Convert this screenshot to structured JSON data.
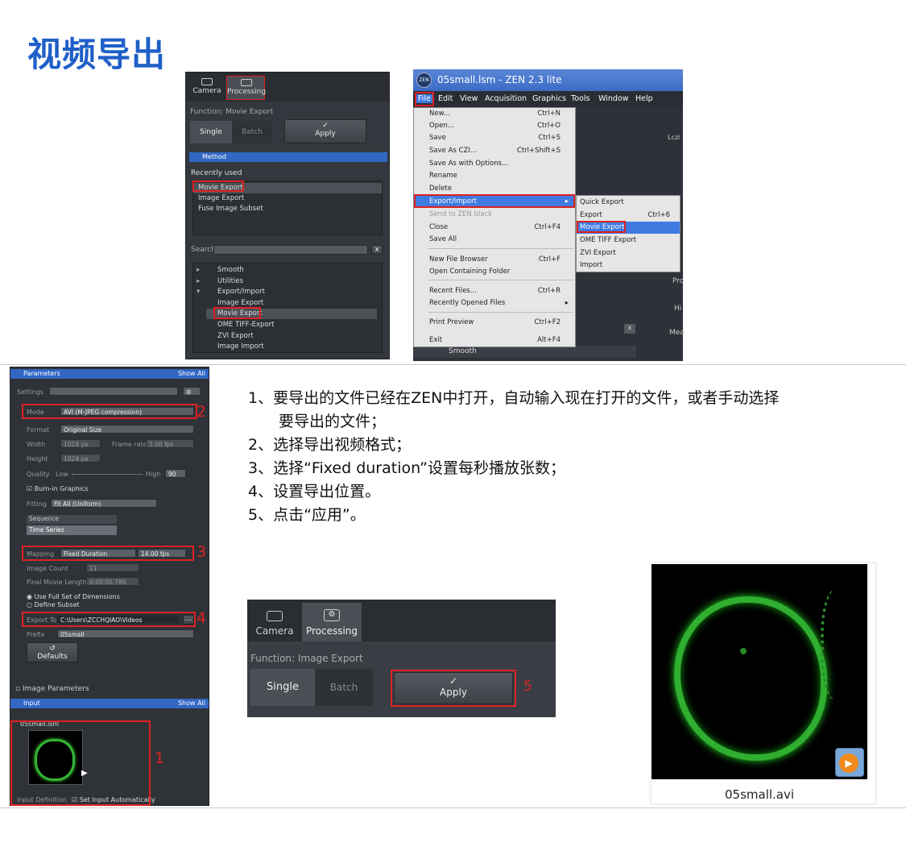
{
  "page": {
    "title": "视频导出"
  },
  "panel_processing": {
    "tabs": [
      "Camera",
      "Processing"
    ],
    "function_label": "Function:",
    "function_value": "Movie Export",
    "single": "Single",
    "batch": "Batch",
    "apply": "Apply",
    "method_header": "Method",
    "recently_used": "Recently used",
    "recent_items": [
      "Movie Export",
      "Image Export",
      "Fuse Image Subset"
    ],
    "search_label": "Search",
    "search_clear": "x",
    "tree": [
      "Smooth",
      "Utilities",
      "Export/Import",
      "Image Export",
      "Movie Export",
      "OME TIFF-Export",
      "ZVI Export",
      "Image Import"
    ]
  },
  "zen_window": {
    "logo": "ZEN",
    "title": "05small.lsm - ZEN 2.3 lite",
    "menubar": [
      "File",
      "Edit",
      "View",
      "Acquisition",
      "Graphics",
      "Tools",
      "Window",
      "Help"
    ],
    "file_menu": [
      {
        "label": "New...",
        "shortcut": "Ctrl+N"
      },
      {
        "label": "Open...",
        "shortcut": "Ctrl+O"
      },
      {
        "label": "Save",
        "shortcut": "Ctrl+S"
      },
      {
        "label": "Save As CZI...",
        "shortcut": "Ctrl+Shift+S"
      },
      {
        "label": "Save As with Options...",
        "shortcut": ""
      },
      {
        "label": "Rename",
        "shortcut": ""
      },
      {
        "label": "Delete",
        "shortcut": ""
      },
      {
        "label": "Export/Import",
        "shortcut": "▸"
      },
      {
        "label": "Send to ZEN black",
        "shortcut": ""
      },
      {
        "label": "Close",
        "shortcut": "Ctrl+F4"
      },
      {
        "label": "Save All",
        "shortcut": ""
      },
      {
        "label": "New File Browser",
        "shortcut": "Ctrl+F"
      },
      {
        "label": "Open Containing Folder",
        "shortcut": ""
      },
      {
        "label": "Recent Files...",
        "shortcut": "Ctrl+R"
      },
      {
        "label": "Recently Opened Files",
        "shortcut": "▸"
      },
      {
        "label": "Print Preview",
        "shortcut": "Ctrl+F2"
      },
      {
        "label": "Exit",
        "shortcut": "Alt+F4"
      }
    ],
    "submenu": [
      {
        "label": "Quick Export",
        "shortcut": ""
      },
      {
        "label": "Export",
        "shortcut": "Ctrl+6"
      },
      {
        "label": "Movie Export",
        "shortcut": ""
      },
      {
        "label": "OME TIFF Export",
        "shortcut": ""
      },
      {
        "label": "ZVI Export",
        "shortcut": ""
      },
      {
        "label": "Import",
        "shortcut": ""
      }
    ],
    "bg_text": {
      "lczi": "Lczi",
      "pro": "Pro",
      "hi": "Hi",
      "mea": "Mea",
      "x": "x",
      "smooth": "Smooth"
    }
  },
  "parameters": {
    "header": "Parameters",
    "show_all": "Show All",
    "settings": "Settings",
    "mode_label": "Mode",
    "mode_value": "AVI (M-JPEG compression)",
    "format_label": "Format",
    "format_value": "Original Size",
    "width_label": "Width",
    "width_value": "1024 px",
    "frame_rate_label": "Frame rate",
    "frame_rate_value": "5.00 fps",
    "height_label": "Height",
    "height_value": "1024 px",
    "quality_label": "Quality",
    "low": "Low",
    "high": "High",
    "quality_value": "90",
    "burn_in": "Burn-in Graphics",
    "fitting_label": "Fitting",
    "fitting_value": "Fit All (Uniform)",
    "sequence": "Sequence",
    "time_series": "Time Series",
    "mapping_label": "Mapping",
    "mapping_value": "Fixed Duration",
    "fps_value": "14.00 fps",
    "image_count_label": "Image Count",
    "image_count_value": "11",
    "final_length_label": "Final Movie Length",
    "final_length_value": "0:00:00.786",
    "use_full": "Use Full Set of Dimensions",
    "define_subset": "Define Subset",
    "export_to_label": "Export To",
    "export_to_value": "C:\\Users\\ZCCHQIAO\\Videos",
    "prefix_label": "Prefix",
    "prefix_value": "05small",
    "defaults": "Defaults",
    "image_parameters": "Image Parameters",
    "input_header": "Input",
    "input_show_all": "Show All",
    "input_file": "05small.lsm",
    "input_definition": "Input Definition",
    "set_input_auto": "Set Input Automatically"
  },
  "markers": [
    "1",
    "2",
    "3",
    "4",
    "5"
  ],
  "steps": [
    "1、要导出的文件已经在ZEN中打开，自动输入现在打开的文件，或者手动选择",
    "要导出的文件；",
    "2、选择导出视频格式；",
    "3、选择“Fixed duration”设置每秒播放张数；",
    "4、设置导出位置。",
    "5、点击“应用”。"
  ],
  "panel_apply": {
    "tabs": [
      "Camera",
      "Processing"
    ],
    "function_label": "Function:",
    "function_value": "Image Export",
    "single": "Single",
    "batch": "Batch",
    "apply": "Apply"
  },
  "result": {
    "filename": "05small.avi"
  }
}
